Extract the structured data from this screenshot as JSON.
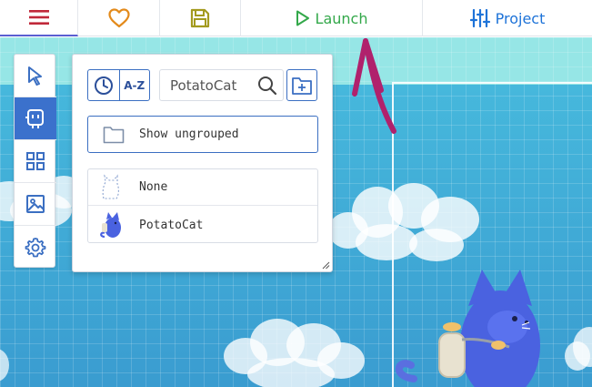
{
  "toolbar": {
    "menu_icon": "hamburger-menu-icon",
    "favorite_icon": "heart-icon",
    "save_icon": "floppy-disk-icon",
    "launch_label": "Launch",
    "launch_icon": "play-icon",
    "project_label": "Project",
    "project_icon": "sliders-icon"
  },
  "left_tools": [
    {
      "name": "select-tool",
      "icon": "cursor-arrow-icon",
      "active": false
    },
    {
      "name": "entities-tool",
      "icon": "robot-sprite-icon",
      "active": true
    },
    {
      "name": "blocks-tool",
      "icon": "grid-icon",
      "active": false
    },
    {
      "name": "media-tool",
      "icon": "image-icon",
      "active": false
    },
    {
      "name": "settings-tool",
      "icon": "gear-icon",
      "active": false
    }
  ],
  "panel": {
    "sort_recent_icon": "clock-icon",
    "sort_alpha_label": "A-Z",
    "search": {
      "value": "PotatoCat",
      "placeholder": ""
    },
    "new_group_icon": "folder-plus-icon",
    "show_ungrouped_label": "Show ungrouped",
    "entities": [
      {
        "name": "None",
        "thumbnail": "dashed-cat-outline"
      },
      {
        "name": "PotatoCat",
        "thumbnail": "potatocat-sprite"
      }
    ]
  },
  "colors": {
    "accent_blue": "#3b71cc",
    "launch_green": "#33a84a",
    "project_blue": "#1e73d8",
    "heart_orange": "#e38a1b",
    "save_olive": "#a39a1e",
    "menu_red": "#c0283a",
    "annotation_arrow": "#b0216c",
    "sky_top": "#96e6e6",
    "sky_main": "#3f9fd0"
  }
}
